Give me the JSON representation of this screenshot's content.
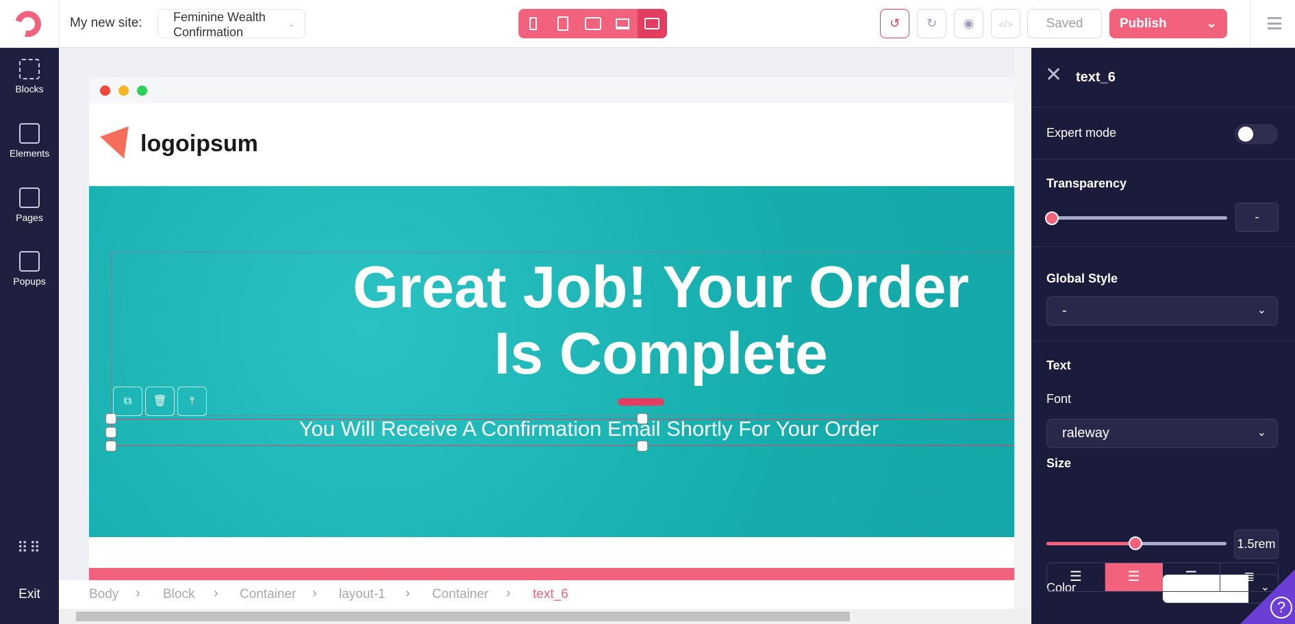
{
  "topbar": {
    "site_label": "My new site:",
    "site_value": "Feminine Wealth Confirmation",
    "saved": "Saved",
    "publish": "Publish"
  },
  "sidebar": {
    "items": [
      {
        "label": "Blocks"
      },
      {
        "label": "Elements"
      },
      {
        "label": "Pages"
      },
      {
        "label": "Popups"
      }
    ],
    "exit": "Exit"
  },
  "canvas": {
    "logo": "logoipsum",
    "heading": "Great Job! Your Order Is Complete",
    "subheading": "You Will Receive A Confirmation Email Shortly For Your Order"
  },
  "breadcrumb": [
    "Body",
    "Block",
    "Container",
    "layout-1",
    "Container",
    "text_6"
  ],
  "panel": {
    "title": "text_6",
    "expert_mode": "Expert mode",
    "expert_on": false,
    "transparency": "Transparency",
    "transparency_value": "-",
    "transparency_level": 0,
    "global_style": "Global Style",
    "global_style_value": "-",
    "text": "Text",
    "font": "Font",
    "font_value": "raleway",
    "size": "Size",
    "size_value": "1.5rem",
    "size_level": 0.5,
    "color": "Color",
    "color_value": "#ffffff",
    "align_selected": "center"
  },
  "colors": {
    "accent": "#f2627c",
    "panel": "#1b1c3b",
    "hero": "#1bb5b5"
  }
}
